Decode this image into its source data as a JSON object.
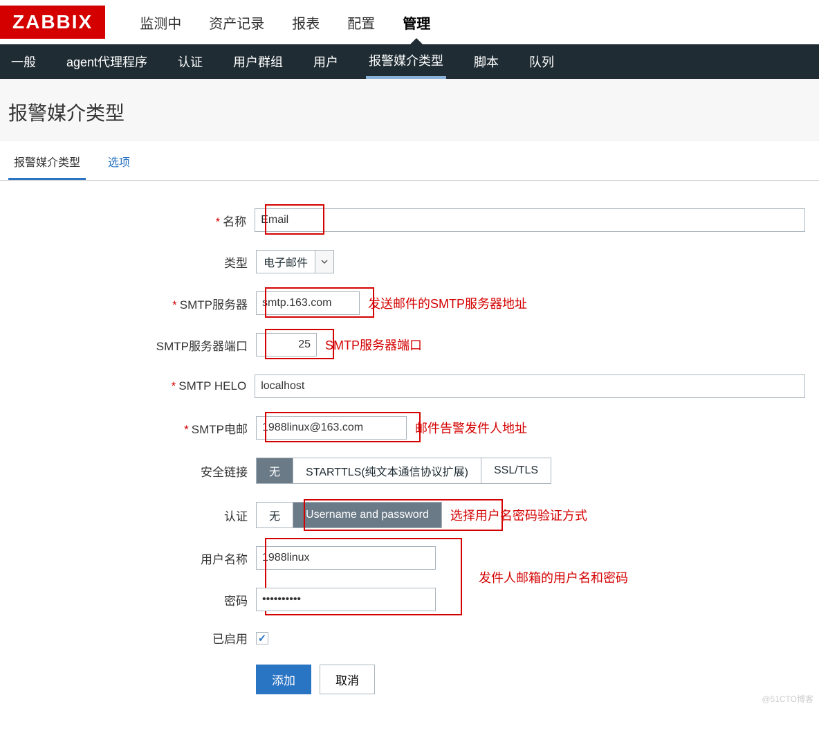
{
  "brand": "ZABBIX",
  "topnav": [
    "监测中",
    "资产记录",
    "报表",
    "配置",
    "管理"
  ],
  "topnav_active_index": 4,
  "subnav": [
    "一般",
    "agent代理程序",
    "认证",
    "用户群组",
    "用户",
    "报警媒介类型",
    "脚本",
    "队列"
  ],
  "subnav_active_index": 5,
  "page_title": "报警媒介类型",
  "content_tabs": [
    "报警媒介类型",
    "选项"
  ],
  "content_tabs_active": 0,
  "form": {
    "name_label": "名称",
    "name_value": "Email",
    "type_label": "类型",
    "type_value": "电子邮件",
    "smtp_server_label": "SMTP服务器",
    "smtp_server_value": "smtp.163.com",
    "smtp_server_note": "发送邮件的SMTP服务器地址",
    "smtp_port_label": "SMTP服务器端口",
    "smtp_port_value": "25",
    "smtp_port_note": "SMTP服务器端口",
    "smtp_helo_label": "SMTP HELO",
    "smtp_helo_value": "localhost",
    "smtp_email_label": "SMTP电邮",
    "smtp_email_value": "1988linux@163.com",
    "smtp_email_note": "邮件告警发件人地址",
    "security_label": "安全链接",
    "security_options": [
      "无",
      "STARTTLS(纯文本通信协议扩展)",
      "SSL/TLS"
    ],
    "security_selected": 0,
    "auth_label": "认证",
    "auth_options": [
      "无",
      "Username and password"
    ],
    "auth_selected": 1,
    "auth_note": "选择用户名密码验证方式",
    "username_label": "用户名称",
    "username_value": "1988linux",
    "password_label": "密码",
    "password_value": "••••••••••",
    "credentials_note": "发件人邮箱的用户名和密码",
    "enabled_label": "已启用",
    "enabled_checked": true,
    "btn_submit": "添加",
    "btn_cancel": "取消"
  },
  "watermark": "@51CTO博客"
}
